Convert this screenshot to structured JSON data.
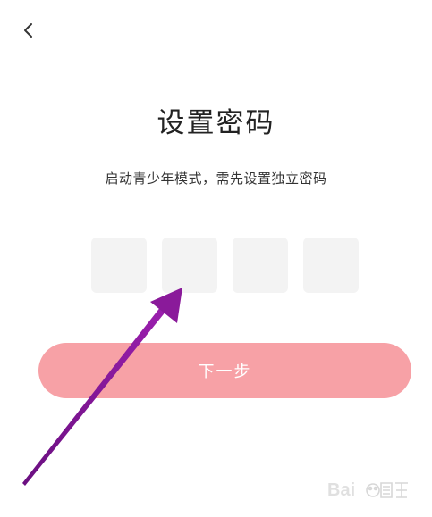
{
  "header": {
    "back_icon": "chevron-left-icon"
  },
  "main": {
    "title": "设置密码",
    "subtitle": "启动青少年模式，需先设置独立密码",
    "pin_boxes": [
      "",
      "",
      "",
      ""
    ],
    "next_label": "下一步"
  },
  "colors": {
    "button": "#f7a1a6",
    "pin_box": "#f3f3f3",
    "annotation_arrow": "#8a1a9a"
  }
}
